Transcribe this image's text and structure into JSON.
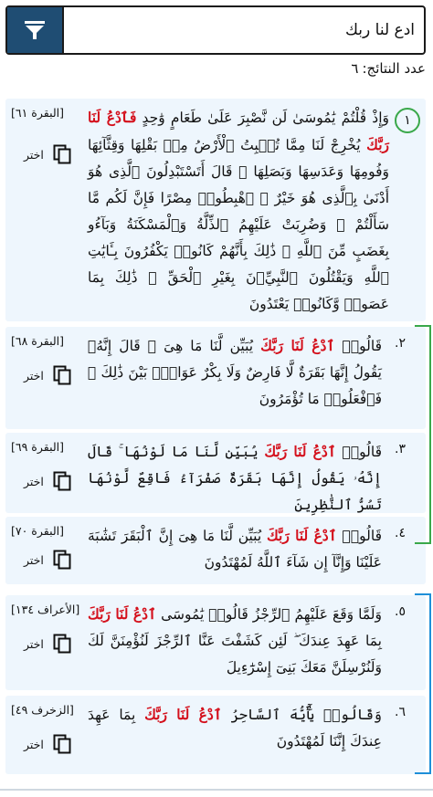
{
  "search": {
    "query": "ادع لنا ربك"
  },
  "results": {
    "count_label": "عدد النتائج:",
    "count": "٦"
  },
  "select_label": "اختر",
  "items": [
    {
      "num": "١",
      "ref": "[البقرة ٦١]",
      "pre": "وَإِذْ قُلْتُمْ يَٰمُوسَىٰ لَن نَّصْبِرَ عَلَىٰ طَعَامٍ وَٰحِدٍ ",
      "hl": "فَٱدْعُ لَنَا رَبَّكَ",
      "post": " يُخْرِجْ لَنَا مِمَّا تُنۢبِتُ ٱلْأَرْضُ مِنۢ بَقْلِهَا وَقِثَّآئِهَا وَفُومِهَا وَعَدَسِهَا وَبَصَلِهَا ۖ قَالَ أَتَسْتَبْدِلُونَ ٱلَّذِى هُوَ أَدْنَىٰ بِٱلَّذِى هُوَ خَيْرٌ ۚ ٱهْبِطُوا۟ مِصْرًا فَإِنَّ لَكُم مَّا سَأَلْتُمْ ۗ وَضُرِبَتْ عَلَيْهِمُ ٱلذِّلَّةُ وَٱلْمَسْكَنَةُ وَبَآءُو بِغَضَبٍ مِّنَ ٱللَّهِ ۗ ذَٰلِكَ بِأَنَّهُمْ كَانُوا۟ يَكْفُرُونَ بِـَٔايَٰتِ ٱللَّهِ وَيَقْتُلُونَ ٱلنَّبِيِّۦنَ بِغَيْرِ ٱلْحَقِّ ۗ ذَٰلِكَ بِمَا عَصَوا۟ وَّكَانُوا۟ يَعْتَدُونَ"
    },
    {
      "num": "٢.",
      "ref": "[البقرة ٦٨]",
      "pre": "قَالُوا۟ ",
      "hl": "ٱدْعُ لَنَا رَبَّكَ",
      "post": " يُبَيِّن لَّنَا مَا هِىَ ۚ قَالَ إِنَّهُۥ يَقُولُ إِنَّهَا بَقَرَةٌ لَّا فَارِضٌ وَلَا بِكْرٌ عَوَانٌۢ بَيْنَ ذَٰلِكَ ۖ فَٱفْعَلُوا۟ مَا تُؤْمَرُونَ"
    },
    {
      "num": "٣.",
      "ref": "[البقرة ٦٩]",
      "pre": "قَالُوا۟ ",
      "hl": "ٱدْعُ لَنَا رَبَّكَ",
      "post": " يُبَيِّن لَّنَا مَا لَوْنُهَا ۚ قَالَ إِنَّهُۥ يَقُولُ إِنَّهَا بَقَرَةٌ صَفْرَآءُ فَاقِعٌ لَّوْنُهَا تَسُرُّ ٱلنَّٰظِرِينَ"
    },
    {
      "num": "٤.",
      "ref": "[البقرة ٧٠]",
      "pre": "قَالُوا۟ ",
      "hl": "ٱدْعُ لَنَا رَبَّكَ",
      "post": " يُبَيِّن لَّنَا مَا هِىَ إِنَّ ٱلْبَقَرَ تَشَٰبَهَ عَلَيْنَا وَإِنَّآ إِن شَآءَ ٱللَّهُ لَمُهْتَدُونَ"
    },
    {
      "num": "٥.",
      "ref": "[الأعراف ١٣٤]",
      "pre": "وَلَمَّا وَقَعَ عَلَيْهِمُ ٱلرِّجْزُ قَالُوا۟ يَٰمُوسَى ",
      "hl": "ٱدْعُ لَنَا رَبَّكَ",
      "post": " بِمَا عَهِدَ عِندَكَ ۖ لَئِن كَشَفْتَ عَنَّا ٱلرِّجْزَ لَنُؤْمِنَنَّ لَكَ وَلَنُرْسِلَنَّ مَعَكَ بَنِىٓ إِسْرَٰٓءِيلَ"
    },
    {
      "num": "٦.",
      "ref": "[الزخرف ٤٩]",
      "pre": "وَقَالُوا۟ يَٰٓأَيُّهَ ٱلسَّاحِرُ ",
      "hl": "ٱدْعُ لَنَا رَبَّكَ",
      "post": " بِمَا عَهِدَ عِندَكَ إِنَّنَا لَمُهْتَدُونَ"
    }
  ],
  "colors": {
    "highlight": "#d4101c",
    "filter_button": "#1f4d73",
    "card_background": "#eef6fd",
    "group_bracket_1": "#3aa84a",
    "group_bracket_2": "#1e8fd8"
  }
}
